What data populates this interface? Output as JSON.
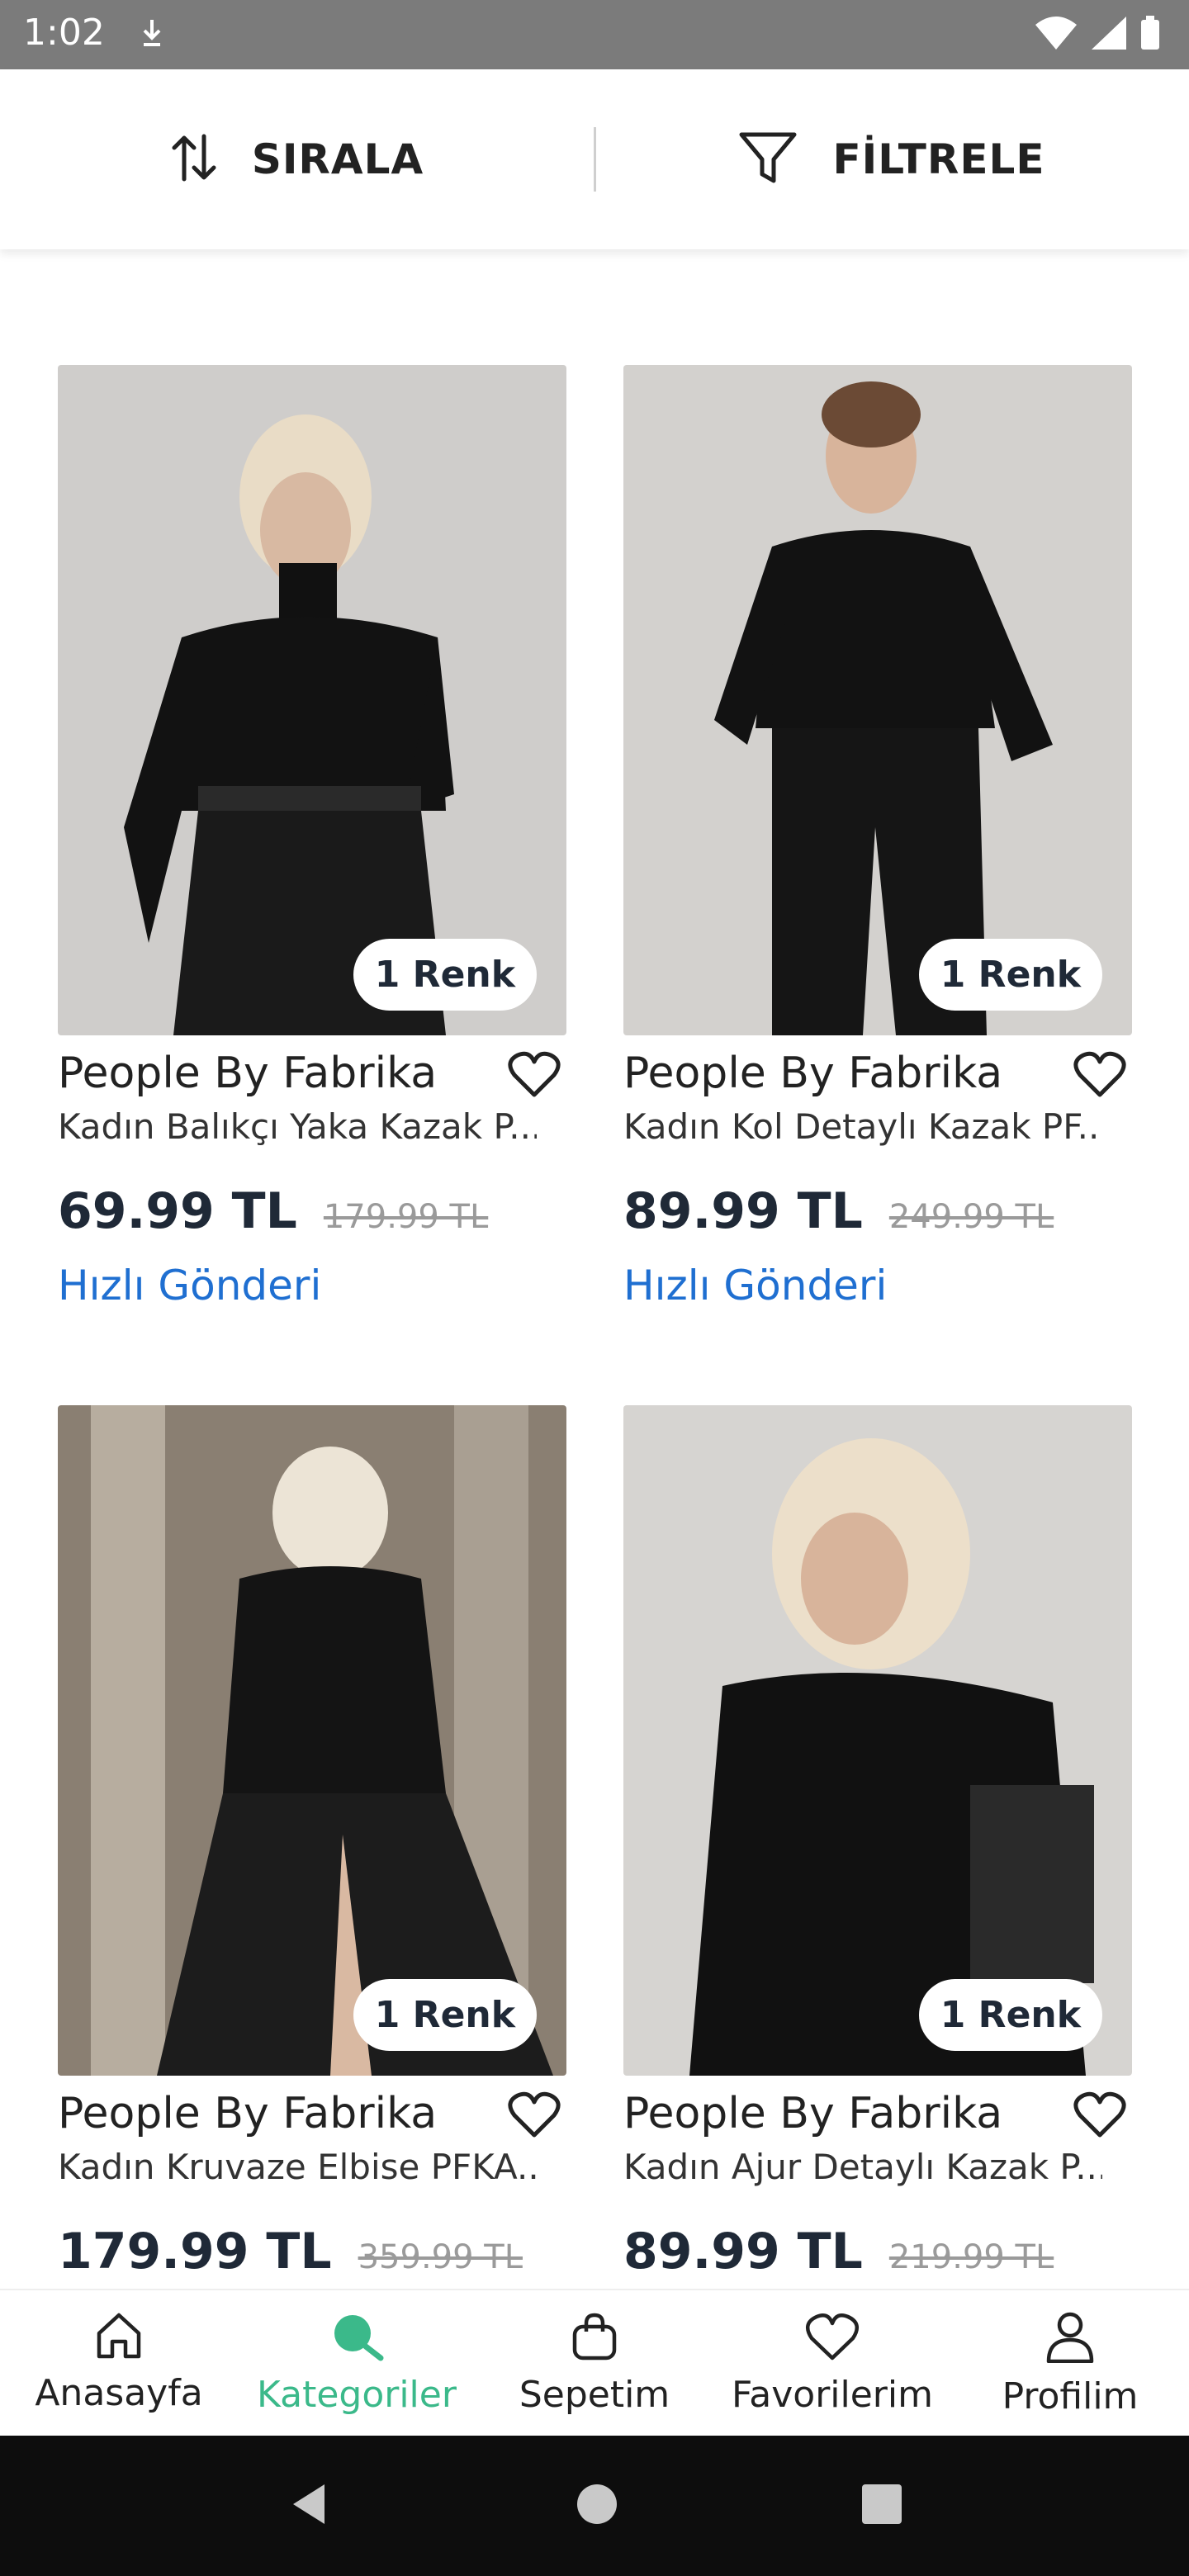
{
  "status_bar": {
    "time": "1:02"
  },
  "toolbar": {
    "sort_label": "SIRALA",
    "filter_label": "FİLTRELE"
  },
  "products": [
    {
      "brand": "People By Fabrika",
      "desc": "Kadın Balıkçı Yaka  Kazak P...",
      "price": "69.99 TL",
      "old_price": "179.99 TL",
      "colors": "1 Renk",
      "shipping": "Hızlı Gönderi"
    },
    {
      "brand": "People By Fabrika",
      "desc": "Kadın Kol Detaylı  Kazak PF...",
      "price": "89.99 TL",
      "old_price": "249.99 TL",
      "colors": "1 Renk",
      "shipping": "Hızlı Gönderi"
    },
    {
      "brand": "People By Fabrika",
      "desc": "Kadın Kruvaze  Elbise PFKA...",
      "price": "179.99 TL",
      "old_price": "359.99 TL",
      "colors": "1 Renk"
    },
    {
      "brand": "People By Fabrika",
      "desc": "Kadın Ajur Detaylı  Kazak P...",
      "price": "89.99 TL",
      "old_price": "219.99 TL",
      "colors": "1 Renk"
    }
  ],
  "bottom_nav": [
    {
      "label": "Anasayfa",
      "icon": "home-icon"
    },
    {
      "label": "Kategoriler",
      "icon": "search-icon",
      "active": true
    },
    {
      "label": "Sepetim",
      "icon": "bag-icon"
    },
    {
      "label": "Favorilerim",
      "icon": "heart-icon"
    },
    {
      "label": "Profilim",
      "icon": "user-icon"
    }
  ],
  "colors": {
    "accent": "#3bb98a",
    "link": "#1f6fd1",
    "price": "#1f2937"
  }
}
